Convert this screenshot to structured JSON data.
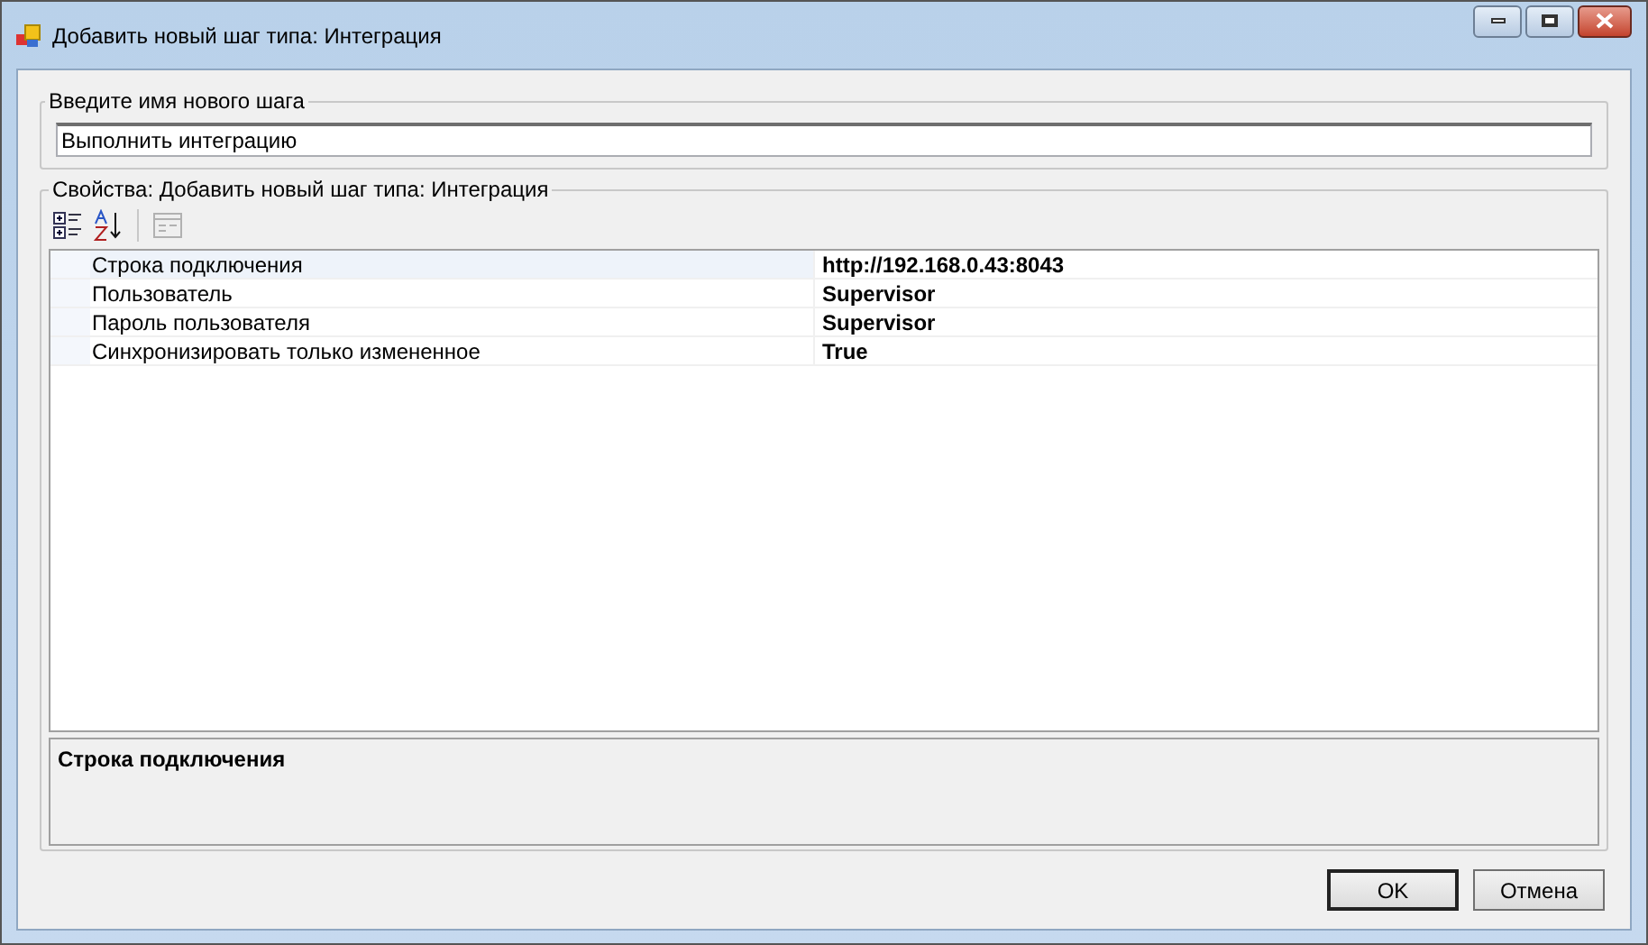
{
  "window": {
    "title": "Добавить новый шаг типа: Интеграция"
  },
  "name_group": {
    "legend": "Введите имя нового шага",
    "value": "Выполнить интеграцию"
  },
  "properties": {
    "legend": "Свойства: Добавить новый шаг типа: Интеграция",
    "toolbar": [
      {
        "kind": "categorized",
        "disabled": false
      },
      {
        "kind": "alphabetical",
        "disabled": false
      },
      {
        "kind": "pages",
        "disabled": true
      }
    ],
    "rows": [
      {
        "name": "Строка подключения",
        "value": "http://192.168.0.43:8043",
        "selected": true
      },
      {
        "name": "Пользователь",
        "value": "Supervisor",
        "selected": false
      },
      {
        "name": "Пароль пользователя",
        "value": "Supervisor",
        "selected": false
      },
      {
        "name": "Синхронизировать только измененное",
        "value": "True",
        "selected": false
      }
    ],
    "description": {
      "title": "Строка подключения"
    }
  },
  "buttons": [
    {
      "label": "OK",
      "default": true
    },
    {
      "label": "Отмена",
      "default": false
    }
  ]
}
